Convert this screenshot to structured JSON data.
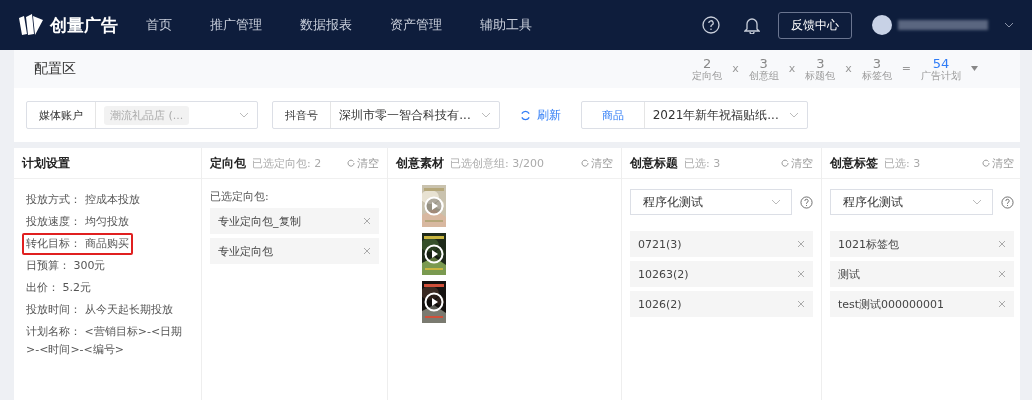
{
  "nav": {
    "logo": "创量广告",
    "items": [
      {
        "label": "首页",
        "selected": false
      },
      {
        "label": "推广管理",
        "selected": false
      },
      {
        "label": "数据报表",
        "selected": false
      },
      {
        "label": "资产管理",
        "selected": false
      },
      {
        "label": "辅助工具",
        "selected": false
      }
    ],
    "feedback": "反馈中心"
  },
  "config": {
    "title": "配置区",
    "formula": [
      {
        "kind": "term",
        "value": "2",
        "label": "定向包"
      },
      {
        "kind": "op",
        "value": "x"
      },
      {
        "kind": "term",
        "value": "3",
        "label": "创意组"
      },
      {
        "kind": "op",
        "value": "x"
      },
      {
        "kind": "term",
        "value": "3",
        "label": "标题包"
      },
      {
        "kind": "op",
        "value": "x"
      },
      {
        "kind": "term",
        "value": "3",
        "label": "标签包"
      },
      {
        "kind": "op",
        "value": "="
      },
      {
        "kind": "total",
        "value": "54",
        "label": "广告计划"
      }
    ]
  },
  "filters": [
    {
      "label": "媒体账户",
      "value": "潮流礼品店 (...",
      "kind": "tag"
    },
    {
      "label": "抖音号",
      "value": "深圳市零一智合科技有...",
      "kind": "text",
      "accent": false
    },
    {
      "kind": "refresh",
      "value": "刷新"
    },
    {
      "label": "商品",
      "value": "2021年新年祝福贴纸...",
      "kind": "text",
      "accent": true
    }
  ],
  "plan": {
    "title": "计划设置",
    "rows": [
      {
        "label": "投放方式：",
        "value": "控成本投放",
        "highlighted": false
      },
      {
        "label": "投放速度：",
        "value": "均匀投放",
        "highlighted": false
      },
      {
        "label": "转化目标：",
        "value": "商品购买",
        "highlighted": true
      },
      {
        "label": "日预算：",
        "value": "300元",
        "highlighted": false
      },
      {
        "label": "出价：",
        "value": "5.2元",
        "highlighted": false
      },
      {
        "label": "投放时间：",
        "value": "从今天起长期投放",
        "highlighted": false
      },
      {
        "label": "计划名称：",
        "value": "<营销目标>-<日期>-<时间>-<编号>",
        "highlighted": false
      }
    ]
  },
  "targeting": {
    "title": "定向包",
    "count": "已选定向包: 2",
    "clear": "清空",
    "subtitle": "已选定向包:",
    "items": [
      "专业定向包_复制",
      "专业定向包"
    ]
  },
  "materials": {
    "title": "创意素材",
    "count": "已选创意组: 3/200",
    "clear": "清空"
  },
  "titles": {
    "title": "创意标题",
    "count": "已选: 3",
    "clear": "清空",
    "select": "程序化测试",
    "items": [
      "0721(3)",
      "10263(2)",
      "1026(2)"
    ]
  },
  "tags": {
    "title": "创意标签",
    "count": "已选: 3",
    "clear": "清空",
    "select": "程序化测试",
    "items": [
      "1021标签包",
      "测试",
      "test测试000000001"
    ]
  }
}
